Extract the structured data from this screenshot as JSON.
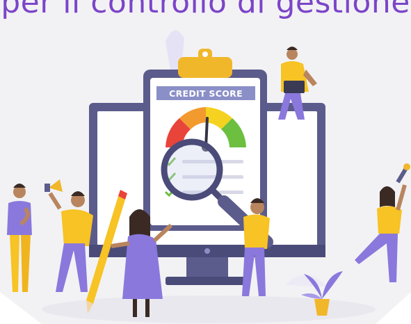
{
  "heading": {
    "text": "per il controllo di gestione"
  },
  "clipboard": {
    "badge": "CREDIT SCORE"
  },
  "colors": {
    "heading": "#7b45c8",
    "monitor_frame": "#5b5b8c",
    "badge_bg": "#8a8fc7",
    "gauge_red": "#e8443a",
    "gauge_orange": "#f29a2e",
    "gauge_yellow": "#f5d21f",
    "gauge_green": "#6cbf3f",
    "clip_gold": "#f1b72b",
    "shirt_yellow": "#f7c325",
    "pants_purple": "#8a78dd"
  }
}
